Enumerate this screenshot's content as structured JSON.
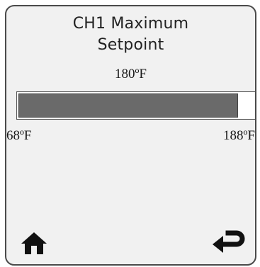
{
  "screen": {
    "title_line1": "CH1 Maximum",
    "title_line2": "Setpoint",
    "current_value": "180ºF"
  },
  "slider": {
    "min_label": "68ºF",
    "max_label": "188ºF",
    "min_value": 68,
    "max_value": 188,
    "value": 180
  },
  "buttons": {
    "home_icon": "home-icon",
    "back_icon": "return-arrow-icon"
  },
  "colors": {
    "fill": "#6a6a6a",
    "background": "#f1f1f1"
  }
}
